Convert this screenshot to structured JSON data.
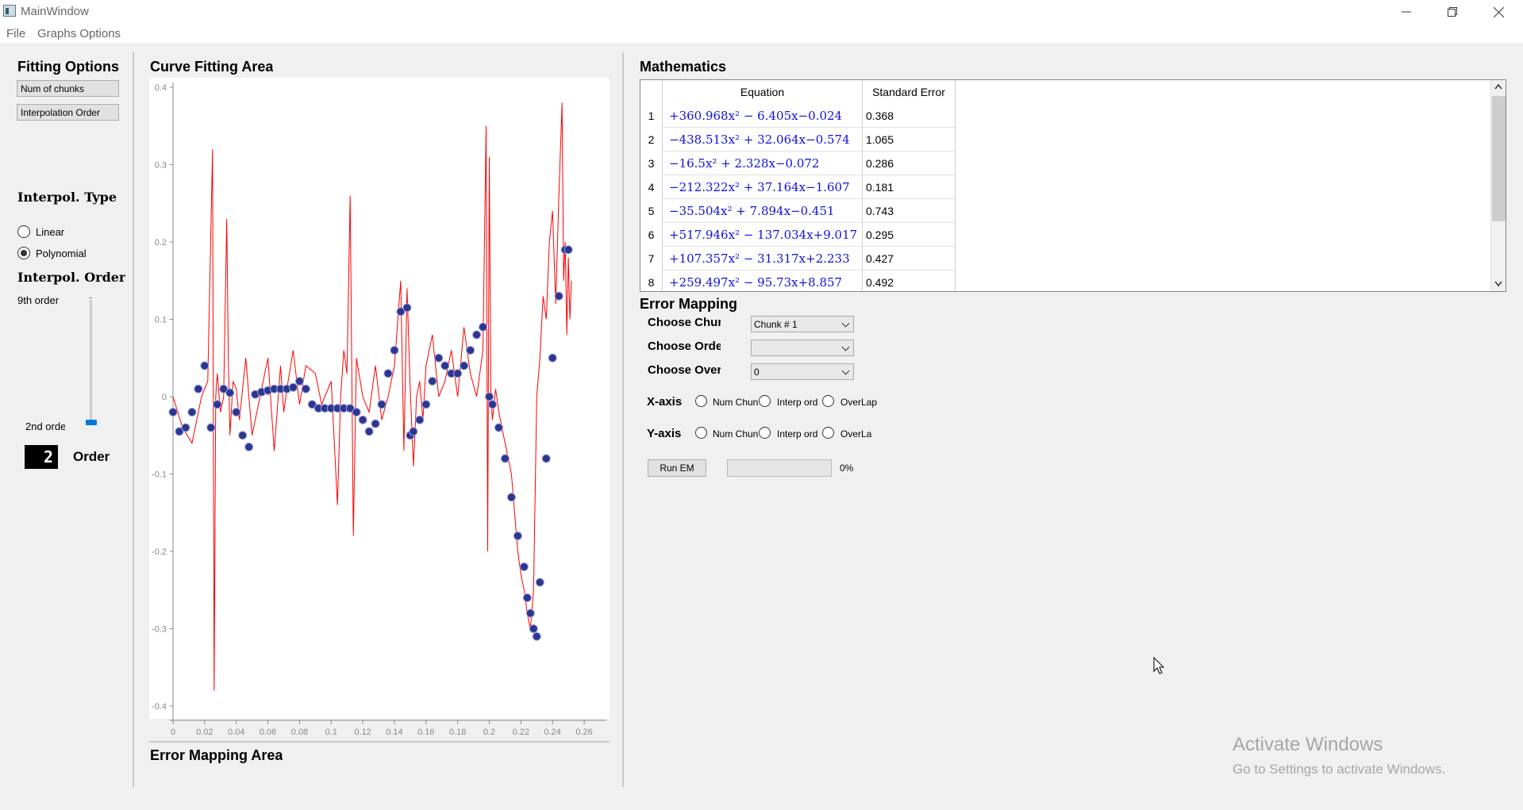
{
  "window": {
    "title": "MainWindow",
    "minimize_icon": "minimize-icon",
    "maximize_icon": "restore-icon",
    "close_icon": "close-icon"
  },
  "menu": {
    "file": "File",
    "graphs_options": "Graphs Options"
  },
  "fitting_options": {
    "title": "Fitting Options",
    "num_chunks_button": "Num of chunks",
    "interp_order_button": "Interpolation Order"
  },
  "interp_type": {
    "title": "Interpol. Type",
    "linear": "Linear",
    "polynomial": "Polynomial",
    "selected": "Polynomial"
  },
  "interp_order": {
    "title": "Interpol. Order",
    "top_label": "9th order",
    "bottom_label": "2nd orde",
    "slider_value": 2,
    "slider_min": 2,
    "slider_max": 9,
    "lcd_value": "2",
    "order_label": "Order"
  },
  "curve_area": {
    "title": "Curve Fitting Area",
    "error_mapping_title": "Error Mapping Area"
  },
  "chart_data": {
    "type": "line",
    "xlim": [
      0,
      0.27
    ],
    "ylim": [
      -0.4,
      0.4
    ],
    "x_ticks": [
      "0",
      "0.02",
      "0.04",
      "0.06",
      "0.08",
      "0.1",
      "0.12",
      "0.14",
      "0.16",
      "0.18",
      "0.2",
      "0.22",
      "0.24",
      "0.26"
    ],
    "y_ticks": [
      "0.4",
      "0.3",
      "0.2",
      "0.1",
      "0",
      "-0.1",
      "-0.2",
      "-0.3",
      "-0.4"
    ],
    "series": [
      {
        "color": "#ff0000",
        "kind": "line",
        "x": [
          0,
          0.006,
          0.012,
          0.018,
          0.022,
          0.025,
          0.026,
          0.027,
          0.028,
          0.03,
          0.032,
          0.034,
          0.035,
          0.036,
          0.038,
          0.04,
          0.042,
          0.046,
          0.05,
          0.055,
          0.06,
          0.064,
          0.068,
          0.07,
          0.072,
          0.076,
          0.08,
          0.084,
          0.09,
          0.094,
          0.1,
          0.104,
          0.106,
          0.108,
          0.11,
          0.112,
          0.114,
          0.116,
          0.12,
          0.124,
          0.128,
          0.132,
          0.136,
          0.14,
          0.144,
          0.146,
          0.148,
          0.15,
          0.152,
          0.154,
          0.156,
          0.158,
          0.16,
          0.164,
          0.168,
          0.172,
          0.176,
          0.18,
          0.184,
          0.188,
          0.192,
          0.196,
          0.198,
          0.199,
          0.2,
          0.201,
          0.202,
          0.204,
          0.206,
          0.21,
          0.214,
          0.218,
          0.22,
          0.222,
          0.224,
          0.226,
          0.228,
          0.23,
          0.232,
          0.234,
          0.236,
          0.238,
          0.24,
          0.242,
          0.244,
          0.246,
          0.247,
          0.248,
          0.249,
          0.25,
          0.251,
          0.252
        ],
        "y": [
          0.0,
          -0.04,
          -0.06,
          0.0,
          0.02,
          0.32,
          -0.38,
          0.0,
          0.03,
          -0.02,
          0.0,
          0.23,
          0.05,
          -0.05,
          0.02,
          0.01,
          -0.03,
          0.05,
          -0.05,
          0.0,
          0.05,
          -0.07,
          0.04,
          -0.02,
          0.01,
          0.06,
          -0.01,
          0.04,
          0.03,
          -0.01,
          0.02,
          -0.14,
          0.0,
          0.06,
          0.03,
          0.26,
          -0.18,
          0.05,
          0.0,
          -0.02,
          0.04,
          -0.03,
          0.0,
          0.04,
          0.15,
          -0.07,
          0.14,
          0.01,
          -0.09,
          0.0,
          0.02,
          -0.03,
          0.04,
          0.08,
          0.0,
          0.02,
          0.06,
          0.0,
          0.09,
          0.03,
          0.0,
          0.06,
          0.35,
          -0.2,
          0.31,
          0.0,
          -0.03,
          0.01,
          -0.02,
          -0.06,
          -0.1,
          -0.2,
          -0.23,
          -0.25,
          -0.28,
          -0.3,
          -0.25,
          0.0,
          0.05,
          0.13,
          0.1,
          0.2,
          0.24,
          0.12,
          0.26,
          0.38,
          0.15,
          0.2,
          0.08,
          0.18,
          0.1,
          0.15
        ]
      },
      {
        "color": "#2c3590",
        "kind": "markers",
        "x": [
          0.0,
          0.004,
          0.008,
          0.012,
          0.016,
          0.02,
          0.024,
          0.028,
          0.032,
          0.036,
          0.04,
          0.044,
          0.048,
          0.052,
          0.056,
          0.06,
          0.064,
          0.068,
          0.072,
          0.076,
          0.08,
          0.084,
          0.088,
          0.092,
          0.096,
          0.1,
          0.104,
          0.108,
          0.112,
          0.116,
          0.12,
          0.124,
          0.128,
          0.132,
          0.136,
          0.14,
          0.144,
          0.148,
          0.15,
          0.152,
          0.156,
          0.16,
          0.164,
          0.168,
          0.172,
          0.176,
          0.18,
          0.184,
          0.188,
          0.192,
          0.196,
          0.2,
          0.202,
          0.206,
          0.21,
          0.214,
          0.218,
          0.222,
          0.224,
          0.226,
          0.228,
          0.23,
          0.232,
          0.236,
          0.24,
          0.244,
          0.248,
          0.25
        ],
        "y": [
          -0.02,
          -0.045,
          -0.04,
          -0.02,
          0.01,
          0.04,
          -0.04,
          -0.01,
          0.01,
          0.005,
          -0.02,
          -0.05,
          -0.065,
          0.003,
          0.006,
          0.008,
          0.01,
          0.01,
          0.01,
          0.012,
          0.02,
          0.01,
          -0.01,
          -0.015,
          -0.015,
          -0.015,
          -0.015,
          -0.015,
          -0.015,
          -0.02,
          -0.03,
          -0.045,
          -0.035,
          -0.01,
          0.03,
          0.06,
          0.11,
          0.115,
          -0.05,
          -0.045,
          -0.03,
          -0.01,
          0.02,
          0.05,
          0.04,
          0.03,
          0.03,
          0.04,
          0.06,
          0.08,
          0.09,
          0.0,
          -0.01,
          -0.04,
          -0.08,
          -0.13,
          -0.18,
          -0.22,
          -0.26,
          -0.28,
          -0.3,
          -0.31,
          -0.24,
          -0.08,
          0.05,
          0.13,
          0.19,
          0.19
        ]
      }
    ]
  },
  "mathematics": {
    "title": "Mathematics",
    "col_equation": "Equation",
    "col_error": "Standard Error",
    "rows": [
      {
        "n": "1",
        "eq": "+360.968x² − 6.405x−0.024",
        "err": "0.368"
      },
      {
        "n": "2",
        "eq": "−438.513x² + 32.064x−0.574",
        "err": "1.065"
      },
      {
        "n": "3",
        "eq": "−16.5x² + 2.328x−0.072",
        "err": "0.286"
      },
      {
        "n": "4",
        "eq": "−212.322x² + 37.164x−1.607",
        "err": "0.181"
      },
      {
        "n": "5",
        "eq": "−35.504x² + 7.894x−0.451",
        "err": "0.743"
      },
      {
        "n": "6",
        "eq": "+517.946x² − 137.034x+9.017",
        "err": "0.295"
      },
      {
        "n": "7",
        "eq": "+107.357x² − 31.317x+2.233",
        "err": "0.427"
      },
      {
        "n": "8",
        "eq": "+259.497x² − 95.73x+8.857",
        "err": "0.492"
      }
    ]
  },
  "error_mapping": {
    "title": "Error Mapping",
    "choose_chunk_label": "Choose Chur",
    "choose_chunk_value": "Chunk # 1",
    "choose_order_label": "Choose Orde",
    "choose_order_value": "",
    "choose_overlap_label": "Choose Over",
    "choose_overlap_value": "0",
    "xaxis_label": "X-axis",
    "yaxis_label": "Y-axis",
    "opt_num_chunks": "Num Chun",
    "opt_interp_order": "Interp ord",
    "opt_overlap_x": "OverLap",
    "opt_overlap_y": "OverLa",
    "run_button": "Run EM",
    "progress": 0,
    "progress_text": "0%"
  },
  "watermark": {
    "line1": "Activate Windows",
    "line2": "Go to Settings to activate Windows."
  }
}
